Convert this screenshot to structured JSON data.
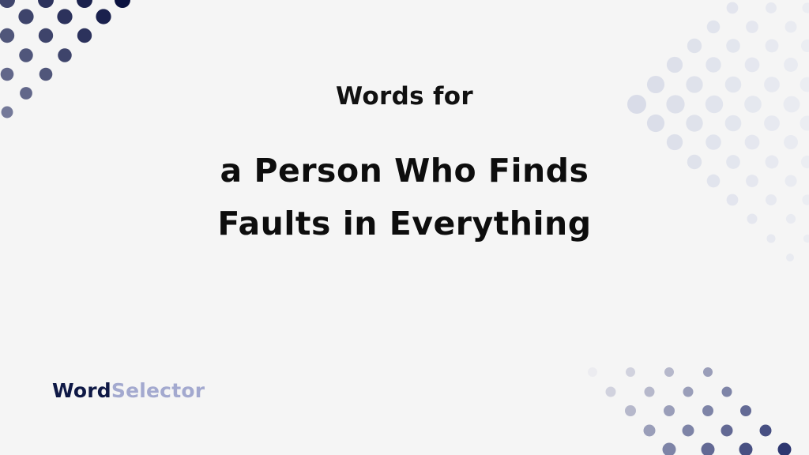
{
  "heading": {
    "kicker": "Words for",
    "line1": "a Person Who Finds",
    "line2": "Faults in Everything"
  },
  "logo": {
    "part1": "Word",
    "part2": "Selector"
  },
  "colors": {
    "background": "#f5f5f5",
    "text": "#111111",
    "brand_dark": "#0e1845",
    "brand_light": "#a3a9cf",
    "dots_dark": "#0b1240",
    "dots_light": "#dde0ea"
  }
}
